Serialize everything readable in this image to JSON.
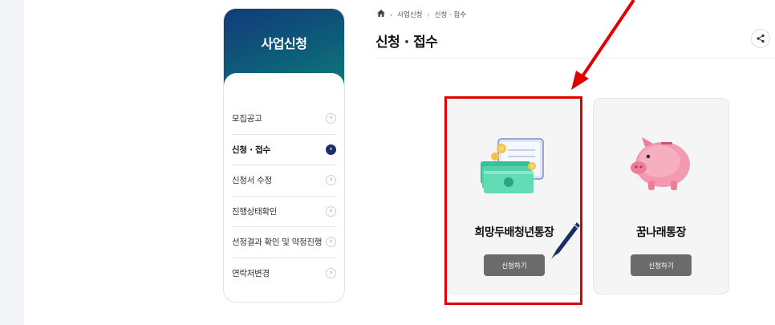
{
  "sidebar": {
    "title": "사업신청",
    "items": [
      {
        "label": "모집공고",
        "active": false
      },
      {
        "label": "신청 · 접수",
        "active": true
      },
      {
        "label": "신청서 수정",
        "active": false
      },
      {
        "label": "진행상태확인",
        "active": false
      },
      {
        "label": "선정결과 확인 및 약정진행",
        "active": false
      },
      {
        "label": "연락처변경",
        "active": false
      }
    ]
  },
  "breadcrumb": {
    "home_icon": "home-icon",
    "items": [
      "사업신청",
      "신청 · 접수"
    ]
  },
  "page": {
    "title": "신청 · 접수",
    "share_icon": "share-icon"
  },
  "cards": [
    {
      "name": "희망두배청년통장",
      "button": "신청하기",
      "icon": "bankbook-money-icon"
    },
    {
      "name": "꿈나래통장",
      "button": "신청하기",
      "icon": "piggy-bank-icon"
    }
  ],
  "colors": {
    "sidebar_gradient_start": "#123a7a",
    "sidebar_gradient_end": "#0f7a76",
    "active_chevron": "#1b2f66",
    "apply_button": "#6b6b6b",
    "highlight": "#e10000"
  }
}
